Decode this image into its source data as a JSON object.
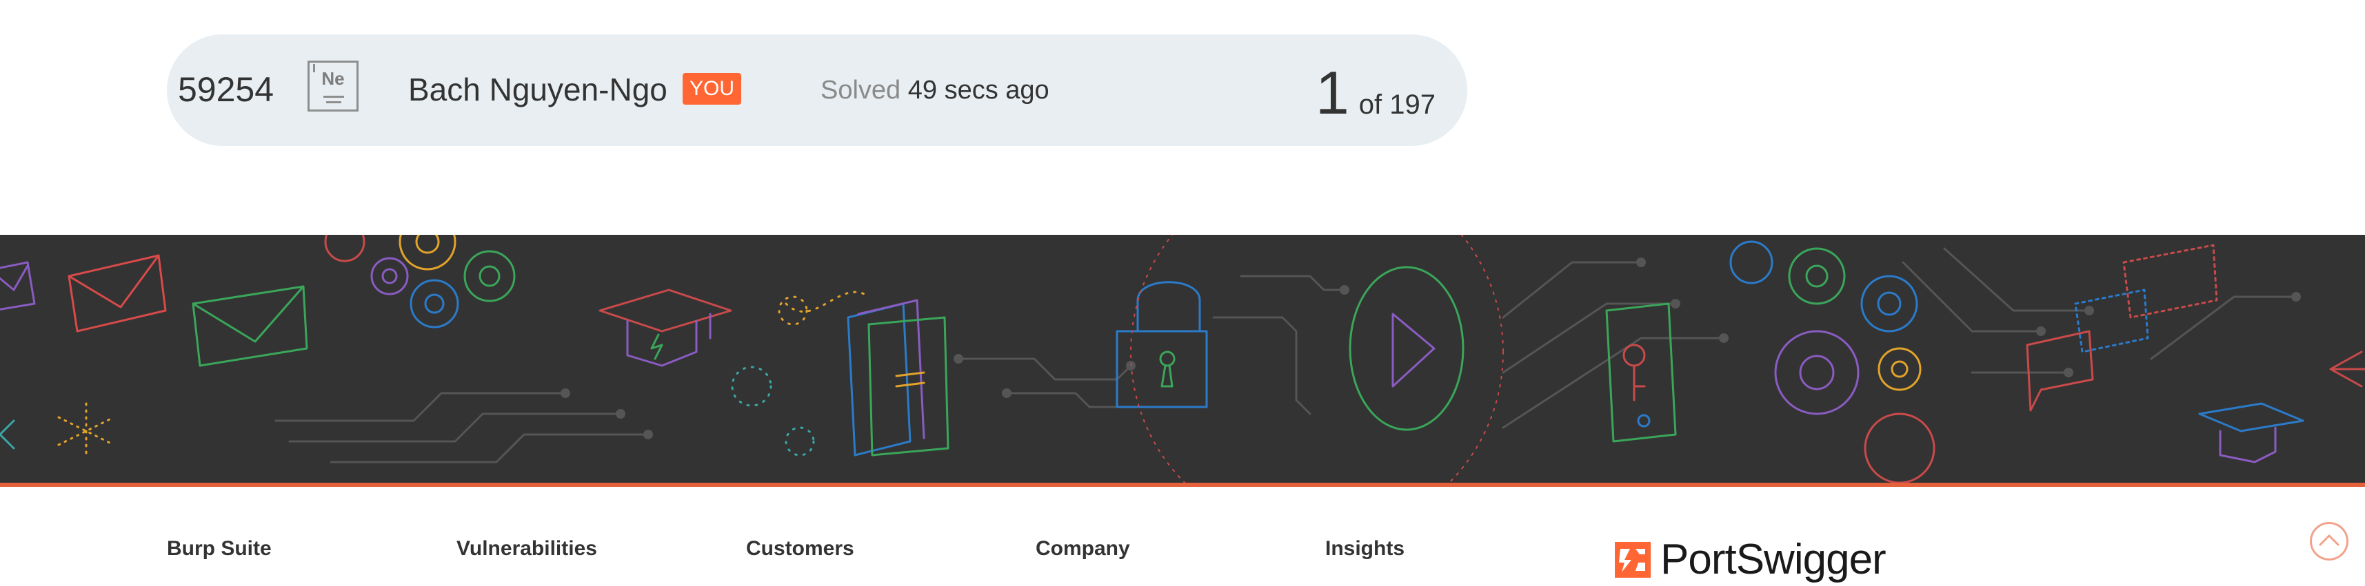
{
  "solve_row": {
    "id": "59254",
    "level_badge": "Ne",
    "user_name": "Bach Nguyen-Ngo",
    "you_badge": "YOU",
    "solved_label": "Solved",
    "solved_time": "49 secs ago",
    "rank": "1",
    "rank_total": "of 197"
  },
  "footer": {
    "nav": [
      {
        "label": "Burp Suite"
      },
      {
        "label": "Vulnerabilities"
      },
      {
        "label": "Customers"
      },
      {
        "label": "Company"
      },
      {
        "label": "Insights"
      }
    ],
    "brand": "PortSwigger"
  },
  "icons": {
    "level": "element-tile-icon",
    "scroll_top": "chevron-up-icon",
    "logo": "portswigger-logo-icon"
  },
  "colors": {
    "accent": "#ff6633",
    "card_bg": "#e8eef1",
    "banner_bg": "#333333"
  }
}
